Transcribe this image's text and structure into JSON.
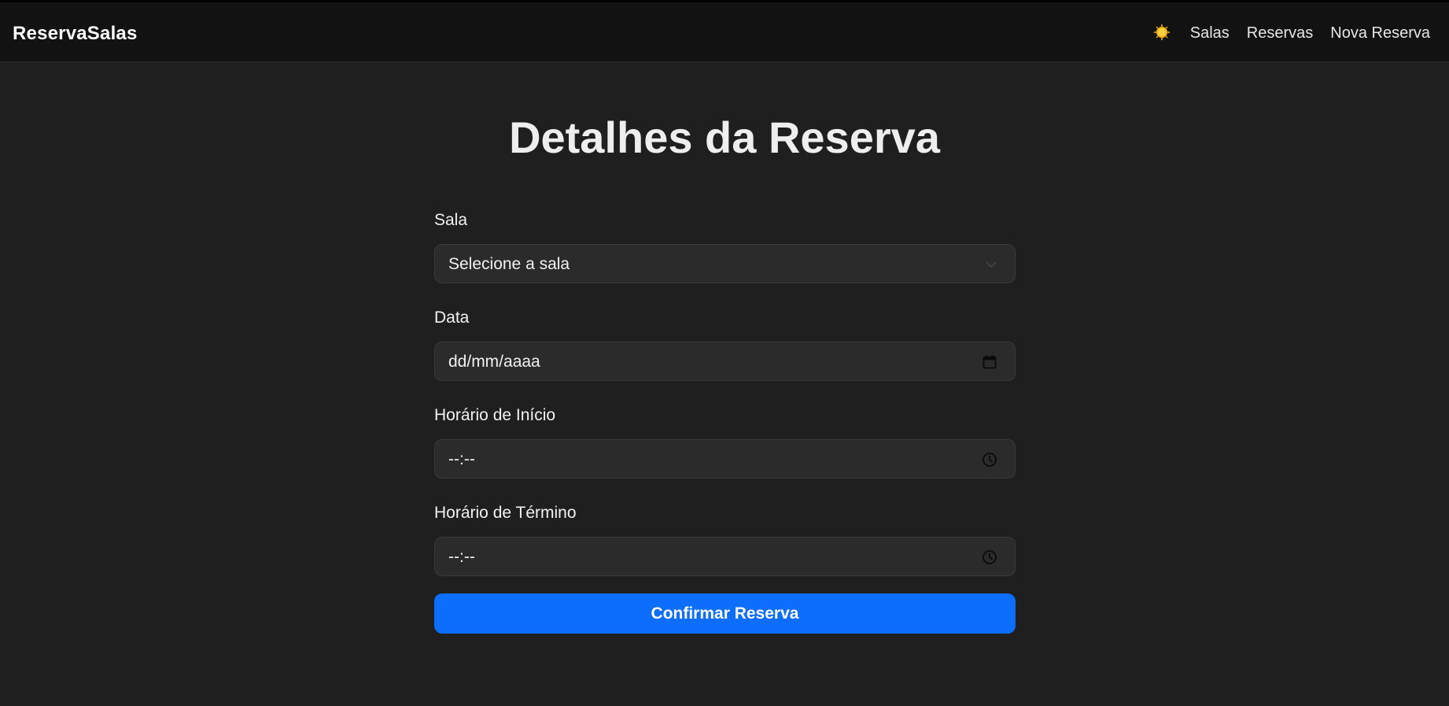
{
  "nav": {
    "brand": "ReservaSalas",
    "theme_icon": "sun-icon",
    "links": [
      "Salas",
      "Reservas",
      "Nova Reserva"
    ]
  },
  "page": {
    "title": "Detalhes da Reserva"
  },
  "form": {
    "room": {
      "label": "Sala",
      "value": "Selecione a sala"
    },
    "date": {
      "label": "Data",
      "value": "dd/mm/aaaa"
    },
    "start_time": {
      "label": "Horário de Início",
      "value": "--:--"
    },
    "end_time": {
      "label": "Horário de Término",
      "value": "--:--"
    },
    "submit_label": "Confirmar Reserva"
  },
  "colors": {
    "background": "#1f1f1f",
    "navbar": "#121212",
    "input_background": "#2b2b2b",
    "accent": "#0d6efd",
    "sun": "#f6b21a"
  }
}
